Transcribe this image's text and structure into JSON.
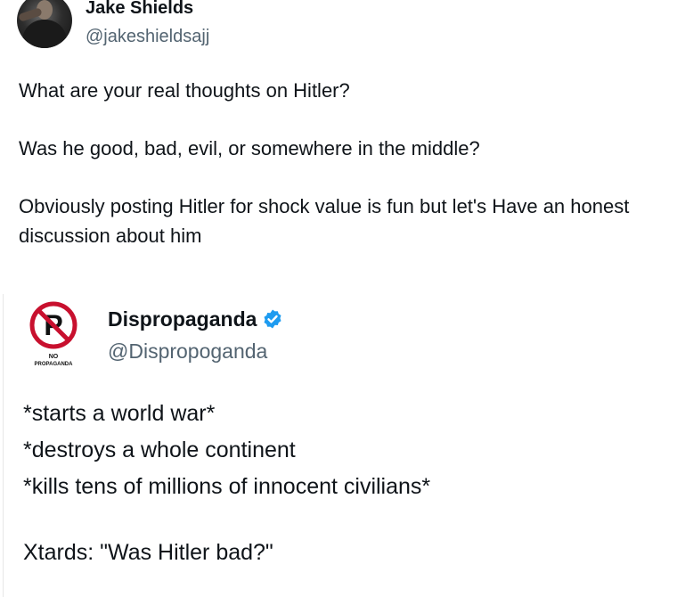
{
  "tweet": {
    "author": {
      "name": "Jake Shields",
      "handle": "@jakeshieldsajj"
    },
    "paragraphs": [
      "What are your real thoughts on Hitler?",
      "Was he good, bad, evil, or somewhere in the middle?",
      "Obviously posting Hitler for shock value is fun but let's Have an honest discussion about him"
    ]
  },
  "quote": {
    "author": {
      "name": "Dispropaganda",
      "handle": "@Dispropoganda",
      "verified": true,
      "avatar_letter": "P",
      "avatar_caption_line1": "NO",
      "avatar_caption_line2": "PROPAGANDA"
    },
    "lines": [
      "*starts a world war*",
      "*destroys a whole continent",
      "*kills tens of millions of innocent civilians*"
    ],
    "closing_line": "Xtards: \"Was Hitler bad?\""
  },
  "colors": {
    "text": "#0f1419",
    "secondary": "#536471",
    "verified_badge": "#1d9bf0",
    "no_sign_red": "#c8102e"
  }
}
